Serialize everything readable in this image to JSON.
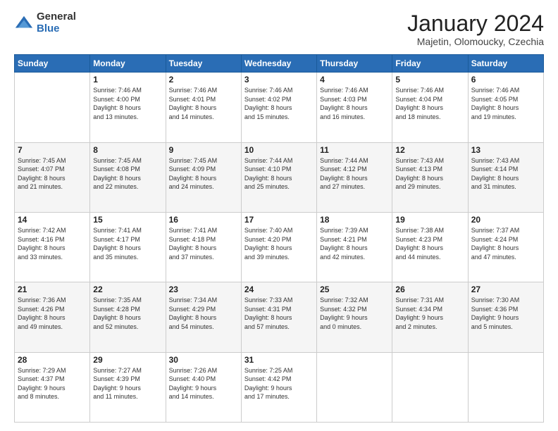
{
  "logo": {
    "general": "General",
    "blue": "Blue"
  },
  "header": {
    "month": "January 2024",
    "location": "Majetin, Olomoucky, Czechia"
  },
  "days_of_week": [
    "Sunday",
    "Monday",
    "Tuesday",
    "Wednesday",
    "Thursday",
    "Friday",
    "Saturday"
  ],
  "weeks": [
    [
      {
        "day": "",
        "info": ""
      },
      {
        "day": "1",
        "info": "Sunrise: 7:46 AM\nSunset: 4:00 PM\nDaylight: 8 hours\nand 13 minutes."
      },
      {
        "day": "2",
        "info": "Sunrise: 7:46 AM\nSunset: 4:01 PM\nDaylight: 8 hours\nand 14 minutes."
      },
      {
        "day": "3",
        "info": "Sunrise: 7:46 AM\nSunset: 4:02 PM\nDaylight: 8 hours\nand 15 minutes."
      },
      {
        "day": "4",
        "info": "Sunrise: 7:46 AM\nSunset: 4:03 PM\nDaylight: 8 hours\nand 16 minutes."
      },
      {
        "day": "5",
        "info": "Sunrise: 7:46 AM\nSunset: 4:04 PM\nDaylight: 8 hours\nand 18 minutes."
      },
      {
        "day": "6",
        "info": "Sunrise: 7:46 AM\nSunset: 4:05 PM\nDaylight: 8 hours\nand 19 minutes."
      }
    ],
    [
      {
        "day": "7",
        "info": "Sunrise: 7:45 AM\nSunset: 4:07 PM\nDaylight: 8 hours\nand 21 minutes."
      },
      {
        "day": "8",
        "info": "Sunrise: 7:45 AM\nSunset: 4:08 PM\nDaylight: 8 hours\nand 22 minutes."
      },
      {
        "day": "9",
        "info": "Sunrise: 7:45 AM\nSunset: 4:09 PM\nDaylight: 8 hours\nand 24 minutes."
      },
      {
        "day": "10",
        "info": "Sunrise: 7:44 AM\nSunset: 4:10 PM\nDaylight: 8 hours\nand 25 minutes."
      },
      {
        "day": "11",
        "info": "Sunrise: 7:44 AM\nSunset: 4:12 PM\nDaylight: 8 hours\nand 27 minutes."
      },
      {
        "day": "12",
        "info": "Sunrise: 7:43 AM\nSunset: 4:13 PM\nDaylight: 8 hours\nand 29 minutes."
      },
      {
        "day": "13",
        "info": "Sunrise: 7:43 AM\nSunset: 4:14 PM\nDaylight: 8 hours\nand 31 minutes."
      }
    ],
    [
      {
        "day": "14",
        "info": "Sunrise: 7:42 AM\nSunset: 4:16 PM\nDaylight: 8 hours\nand 33 minutes."
      },
      {
        "day": "15",
        "info": "Sunrise: 7:41 AM\nSunset: 4:17 PM\nDaylight: 8 hours\nand 35 minutes."
      },
      {
        "day": "16",
        "info": "Sunrise: 7:41 AM\nSunset: 4:18 PM\nDaylight: 8 hours\nand 37 minutes."
      },
      {
        "day": "17",
        "info": "Sunrise: 7:40 AM\nSunset: 4:20 PM\nDaylight: 8 hours\nand 39 minutes."
      },
      {
        "day": "18",
        "info": "Sunrise: 7:39 AM\nSunset: 4:21 PM\nDaylight: 8 hours\nand 42 minutes."
      },
      {
        "day": "19",
        "info": "Sunrise: 7:38 AM\nSunset: 4:23 PM\nDaylight: 8 hours\nand 44 minutes."
      },
      {
        "day": "20",
        "info": "Sunrise: 7:37 AM\nSunset: 4:24 PM\nDaylight: 8 hours\nand 47 minutes."
      }
    ],
    [
      {
        "day": "21",
        "info": "Sunrise: 7:36 AM\nSunset: 4:26 PM\nDaylight: 8 hours\nand 49 minutes."
      },
      {
        "day": "22",
        "info": "Sunrise: 7:35 AM\nSunset: 4:28 PM\nDaylight: 8 hours\nand 52 minutes."
      },
      {
        "day": "23",
        "info": "Sunrise: 7:34 AM\nSunset: 4:29 PM\nDaylight: 8 hours\nand 54 minutes."
      },
      {
        "day": "24",
        "info": "Sunrise: 7:33 AM\nSunset: 4:31 PM\nDaylight: 8 hours\nand 57 minutes."
      },
      {
        "day": "25",
        "info": "Sunrise: 7:32 AM\nSunset: 4:32 PM\nDaylight: 9 hours\nand 0 minutes."
      },
      {
        "day": "26",
        "info": "Sunrise: 7:31 AM\nSunset: 4:34 PM\nDaylight: 9 hours\nand 2 minutes."
      },
      {
        "day": "27",
        "info": "Sunrise: 7:30 AM\nSunset: 4:36 PM\nDaylight: 9 hours\nand 5 minutes."
      }
    ],
    [
      {
        "day": "28",
        "info": "Sunrise: 7:29 AM\nSunset: 4:37 PM\nDaylight: 9 hours\nand 8 minutes."
      },
      {
        "day": "29",
        "info": "Sunrise: 7:27 AM\nSunset: 4:39 PM\nDaylight: 9 hours\nand 11 minutes."
      },
      {
        "day": "30",
        "info": "Sunrise: 7:26 AM\nSunset: 4:40 PM\nDaylight: 9 hours\nand 14 minutes."
      },
      {
        "day": "31",
        "info": "Sunrise: 7:25 AM\nSunset: 4:42 PM\nDaylight: 9 hours\nand 17 minutes."
      },
      {
        "day": "",
        "info": ""
      },
      {
        "day": "",
        "info": ""
      },
      {
        "day": "",
        "info": ""
      }
    ]
  ]
}
